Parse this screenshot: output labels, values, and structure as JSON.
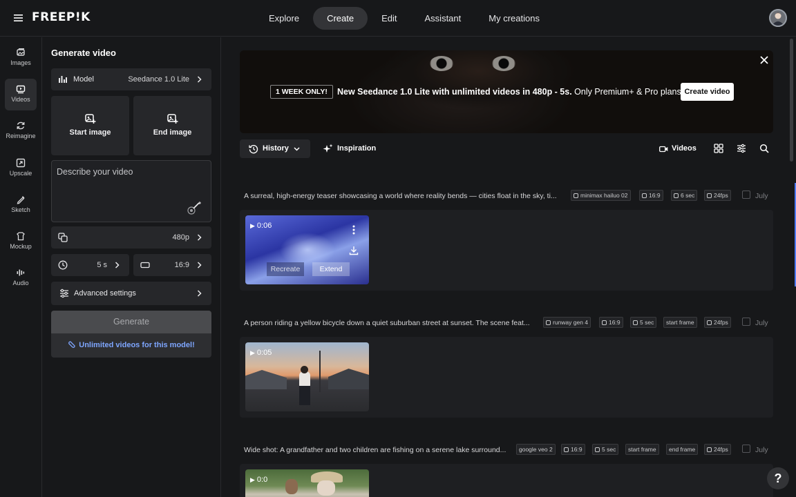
{
  "app": {
    "logo": "FREEP!K"
  },
  "nav": [
    {
      "label": "Explore"
    },
    {
      "label": "Create",
      "active": true
    },
    {
      "label": "Edit"
    },
    {
      "label": "Assistant"
    },
    {
      "label": "My creations"
    }
  ],
  "rail": [
    {
      "label": "Images",
      "icon": "images-icon"
    },
    {
      "label": "Videos",
      "icon": "videos-icon",
      "active": true
    },
    {
      "label": "Reimagine",
      "icon": "reimagine-icon"
    },
    {
      "label": "Upscale",
      "icon": "upscale-icon"
    },
    {
      "label": "Sketch",
      "icon": "sketch-icon"
    },
    {
      "label": "Mockup",
      "icon": "mockup-icon"
    },
    {
      "label": "Audio",
      "icon": "audio-icon"
    }
  ],
  "panel": {
    "title": "Generate video",
    "model_label": "Model",
    "model_value": "Seedance 1.0 Lite",
    "start_image": "Start image",
    "end_image": "End image",
    "prompt_placeholder": "Describe your video",
    "resolution": "480p",
    "duration": "5 s",
    "aspect": "16:9",
    "advanced": "Advanced settings",
    "generate": "Generate",
    "unlimited": "Unlimited videos for this model!"
  },
  "banner": {
    "badge": "1 WEEK ONLY!",
    "text_bold": "New Seedance 1.0 Lite with unlimited videos in 480p - 5s.",
    "text_rest": " Only Premium+ & Pro plans.",
    "button": "Create video"
  },
  "toolbar": {
    "history": "History",
    "inspiration": "Inspiration",
    "videos_filter": "Videos"
  },
  "cards": [
    {
      "prompt": "A surreal, high-energy teaser showcasing a world where reality bends — cities float in the sky, ti...",
      "chips": [
        "minimax hailuo 02",
        "16:9",
        "6 sec",
        "24fps"
      ],
      "date": "July",
      "duration": "0:06",
      "recreate": "Recreate",
      "extend": "Extend"
    },
    {
      "prompt": "A person riding a yellow bicycle down a quiet suburban street at sunset. The scene feat...",
      "chips": [
        "runway gen 4",
        "16:9",
        "5 sec",
        "start frame",
        "24fps"
      ],
      "date": "July",
      "duration": "0:05"
    },
    {
      "prompt": "Wide shot: A grandfather and two children are fishing on a serene lake surround...",
      "chips": [
        "google veo 2",
        "16:9",
        "5 sec",
        "start frame",
        "end frame",
        "24fps"
      ],
      "date": "July",
      "duration": "0:0"
    }
  ],
  "help": "?"
}
